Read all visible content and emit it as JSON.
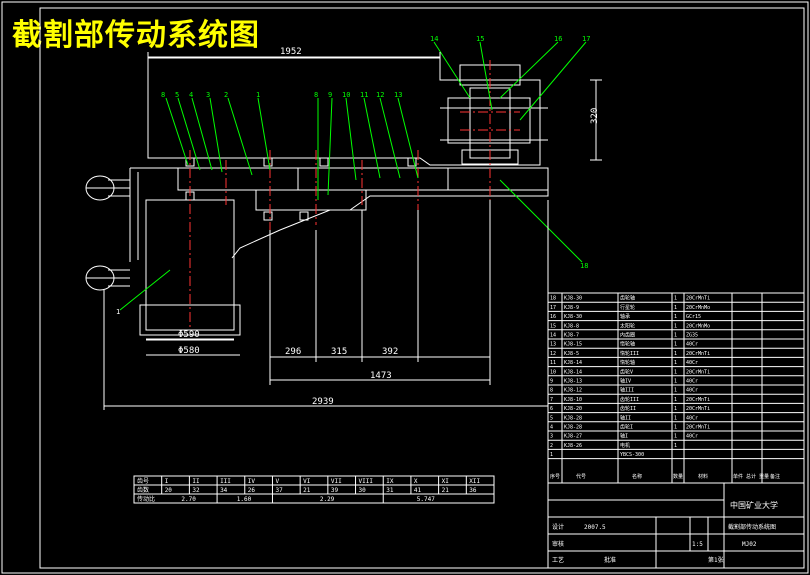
{
  "title": "截割部传动系统图",
  "dimensions": {
    "top_length": "1952",
    "tower_height": "320",
    "drum_dia_inner": "Φ590",
    "drum_dia_outer": "Φ580",
    "d1": "296",
    "d2": "315",
    "d3": "392",
    "d4": "1473",
    "total": "2939"
  },
  "callouts_top": [
    "8",
    "5",
    "4",
    "3",
    "2",
    "1",
    "8",
    "9",
    "10",
    "11",
    "12",
    "13",
    "14",
    "15",
    "16",
    "17"
  ],
  "callout_drum": "1",
  "callout_right": "18",
  "speed_table": {
    "headers": [
      "齿号",
      "I",
      "II",
      "III",
      "IV",
      "V",
      "VI",
      "VII",
      "VIII",
      "IX",
      "X",
      "XI",
      "XII"
    ],
    "teeth": [
      "齿数",
      "20",
      "32",
      "34",
      "26",
      "37",
      "21",
      "39",
      "30",
      "31",
      "41",
      "21",
      "36"
    ],
    "ratio_label": "传动比",
    "ratios": [
      "2.70",
      "1.60",
      "2.29",
      "5.747"
    ]
  },
  "bom": [
    {
      "no": "18",
      "code": "KJ8-30",
      "name": "齿轮轴",
      "qty": "1",
      "mat": "20CrMnTi"
    },
    {
      "no": "17",
      "code": "KJ8-9",
      "name": "行星轮",
      "qty": "1",
      "mat": "20CrMnMo"
    },
    {
      "no": "16",
      "code": "KJ8-30",
      "name": "轴承",
      "qty": "1",
      "mat": "GCr15"
    },
    {
      "no": "15",
      "code": "KJ8-8",
      "name": "太阳轮",
      "qty": "1",
      "mat": "20CrMnMo"
    },
    {
      "no": "14",
      "code": "KJ8-7",
      "name": "内齿圈",
      "qty": "1",
      "mat": "ZG35"
    },
    {
      "no": "13",
      "code": "KJ8-15",
      "name": "惰轮轴",
      "qty": "1",
      "mat": "40Cr"
    },
    {
      "no": "12",
      "code": "KJ8-5",
      "name": "惰轮III",
      "qty": "1",
      "mat": "20CrMnTi"
    },
    {
      "no": "11",
      "code": "KJ8-14",
      "name": "惰轮轴",
      "qty": "1",
      "mat": "40Cr"
    },
    {
      "no": "10",
      "code": "KJ8-14",
      "name": "齿轮V",
      "qty": "1",
      "mat": "20CrMnTi"
    },
    {
      "no": "9",
      "code": "KJ8-13",
      "name": "轴IV",
      "qty": "1",
      "mat": "40Cr"
    },
    {
      "no": "8",
      "code": "KJ8-12",
      "name": "轴III",
      "qty": "1",
      "mat": "40Cr"
    },
    {
      "no": "7",
      "code": "KJ8-10",
      "name": "齿轮III",
      "qty": "1",
      "mat": "20CrMnTi"
    },
    {
      "no": "6",
      "code": "KJ8-20",
      "name": "齿轮II",
      "qty": "1",
      "mat": "20CrMnTi"
    },
    {
      "no": "5",
      "code": "KJ8-28",
      "name": "轴II",
      "qty": "1",
      "mat": "40Cr"
    },
    {
      "no": "4",
      "code": "KJ8-28",
      "name": "齿轮I",
      "qty": "1",
      "mat": "20CrMnTi"
    },
    {
      "no": "3",
      "code": "KJ8-27",
      "name": "轴I",
      "qty": "1",
      "mat": "40Cr"
    },
    {
      "no": "2",
      "code": "KJ8-26",
      "name": "电机",
      "qty": "1",
      "mat": ""
    },
    {
      "no": "1",
      "code": "",
      "name": "YBCS-300",
      "qty": "",
      "mat": ""
    }
  ],
  "bom_header": {
    "no": "序号",
    "code": "代号",
    "name": "名称",
    "qty": "数量",
    "mat": "材料",
    "weight": "单件 总计 重量",
    "note": "备注"
  },
  "title_block": {
    "org": "中国矿业大学",
    "drawing_name": "截割部传动系统图",
    "drawing_no": "MJ02",
    "scale": "1:5",
    "sheet": "第1张",
    "design": "设计",
    "check": "审核",
    "process": "工艺",
    "approve": "批准",
    "date": "2007.5"
  }
}
